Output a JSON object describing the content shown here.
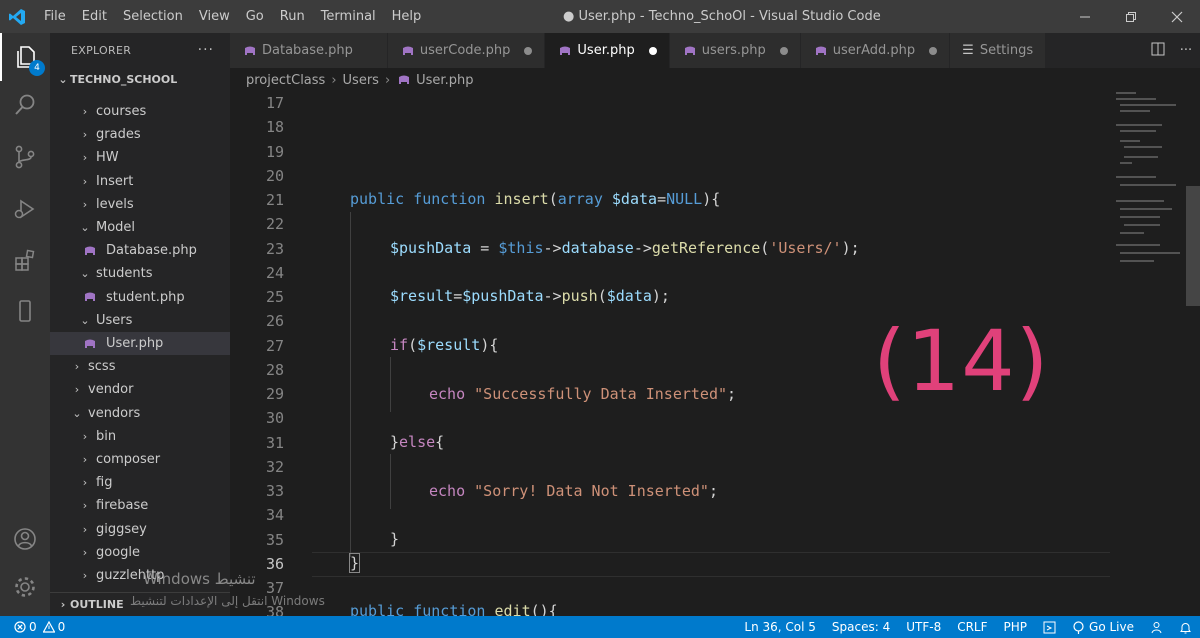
{
  "titlebar": {
    "menu": [
      "File",
      "Edit",
      "Selection",
      "View",
      "Go",
      "Run",
      "Terminal",
      "Help"
    ],
    "window_title": "● User.php - Techno_SchoOl - Visual Studio Code"
  },
  "activity": {
    "explorer_badge": "4"
  },
  "sidebar": {
    "header": "EXPLORER",
    "more": "···",
    "folder": "TECHNO_SCHOOL",
    "tree": [
      {
        "label": "courses",
        "type": "folder",
        "open": false,
        "indent": 1
      },
      {
        "label": "grades",
        "type": "folder",
        "open": false,
        "indent": 1
      },
      {
        "label": "HW",
        "type": "folder",
        "open": false,
        "indent": 1
      },
      {
        "label": "Insert",
        "type": "folder",
        "open": false,
        "indent": 1
      },
      {
        "label": "levels",
        "type": "folder",
        "open": false,
        "indent": 1
      },
      {
        "label": "Model",
        "type": "folder",
        "open": true,
        "indent": 1
      },
      {
        "label": "Database.php",
        "type": "file",
        "indent": 2
      },
      {
        "label": "students",
        "type": "folder",
        "open": true,
        "indent": 1
      },
      {
        "label": "student.php",
        "type": "file",
        "indent": 2
      },
      {
        "label": "Users",
        "type": "folder",
        "open": true,
        "indent": 1
      },
      {
        "label": "User.php",
        "type": "file",
        "indent": 2,
        "selected": true
      },
      {
        "label": "scss",
        "type": "folder",
        "open": false,
        "indent": 0
      },
      {
        "label": "vendor",
        "type": "folder",
        "open": false,
        "indent": 0
      },
      {
        "label": "vendors",
        "type": "folder",
        "open": true,
        "indent": 0
      },
      {
        "label": "bin",
        "type": "folder",
        "open": false,
        "indent": 1
      },
      {
        "label": "composer",
        "type": "folder",
        "open": false,
        "indent": 1
      },
      {
        "label": "fig",
        "type": "folder",
        "open": false,
        "indent": 1
      },
      {
        "label": "firebase",
        "type": "folder",
        "open": false,
        "indent": 1
      },
      {
        "label": "giggsey",
        "type": "folder",
        "open": false,
        "indent": 1
      },
      {
        "label": "google",
        "type": "folder",
        "open": false,
        "indent": 1
      },
      {
        "label": "guzzlehttp",
        "type": "folder",
        "open": false,
        "indent": 1
      }
    ],
    "outline": "OUTLINE"
  },
  "tabs": [
    {
      "label": "Database.php",
      "modified": false,
      "active": false
    },
    {
      "label": "userCode.php",
      "modified": true,
      "active": false
    },
    {
      "label": "User.php",
      "modified": true,
      "active": true
    },
    {
      "label": "users.php",
      "modified": true,
      "active": false
    },
    {
      "label": "userAdd.php",
      "modified": true,
      "active": false
    },
    {
      "label": "Settings",
      "modified": false,
      "active": false,
      "settings": true
    }
  ],
  "breadcrumb": [
    "projectClass",
    "Users",
    "User.php"
  ],
  "editor": {
    "line_numbers": [
      "17",
      "18",
      "19",
      "20",
      "21",
      "22",
      "23",
      "24",
      "25",
      "26",
      "27",
      "28",
      "29",
      "30",
      "31",
      "32",
      "33",
      "34",
      "35",
      "36",
      "37",
      "38"
    ],
    "current_line": "36",
    "overlay": "(14)",
    "code": {
      "l21": [
        "public",
        "function",
        "insert",
        "(",
        "array",
        "$data",
        "=",
        "NULL",
        "){"
      ],
      "l23": [
        "$pushData",
        " = ",
        "$this",
        "->",
        "database",
        "->",
        "getReference",
        "(",
        "'Users/'",
        ");"
      ],
      "l25": [
        "$result",
        "=",
        "$pushData",
        "->",
        "push",
        "(",
        "$data",
        ");"
      ],
      "l27": [
        "if",
        "(",
        "$result",
        "){"
      ],
      "l29": [
        "echo",
        "\"Successfully Data Inserted\"",
        ";"
      ],
      "l31": [
        "}",
        "else",
        "{"
      ],
      "l33": [
        "echo",
        "\"Sorry! Data Not Inserted\"",
        ";"
      ],
      "l35": "}",
      "l36": "}",
      "l38": [
        "public",
        "function",
        "edit",
        "(){"
      ]
    }
  },
  "watermark": {
    "line1": "Windows تنشيط",
    "line2": "انتقل إلى الإعدادات لتنشيط Windows"
  },
  "statusbar": {
    "errors": "0",
    "warnings": "0",
    "position": "Ln 36, Col 5",
    "spaces": "Spaces: 4",
    "encoding": "UTF-8",
    "eol": "CRLF",
    "language": "PHP",
    "golive": "Go Live"
  },
  "colors": {
    "accent": "#007acc",
    "php_icon": "#a074c4",
    "overlay": "#e0417a"
  }
}
